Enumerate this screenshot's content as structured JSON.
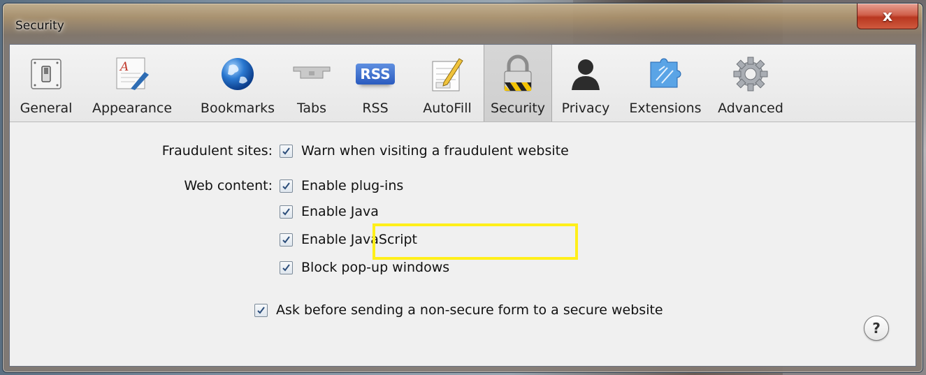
{
  "window": {
    "title": "Security",
    "close_label": "x"
  },
  "toolbar": {
    "items": [
      {
        "label": "General",
        "icon": "general-switch-icon"
      },
      {
        "label": "Appearance",
        "icon": "appearance-icon"
      },
      {
        "label": "Bookmarks",
        "icon": "globe-icon"
      },
      {
        "label": "Tabs",
        "icon": "tabs-icon"
      },
      {
        "label": "RSS",
        "icon": "rss-icon",
        "badge": "RSS"
      },
      {
        "label": "AutoFill",
        "icon": "autofill-icon"
      },
      {
        "label": "Security",
        "icon": "lock-icon",
        "selected": true
      },
      {
        "label": "Privacy",
        "icon": "person-silhouette-icon"
      },
      {
        "label": "Extensions",
        "icon": "puzzle-icon"
      },
      {
        "label": "Advanced",
        "icon": "gear-icon"
      }
    ]
  },
  "security": {
    "fraudulent_label": "Fraudulent sites:",
    "warn_fraudulent": {
      "label": "Warn when visiting a fraudulent website",
      "checked": true
    },
    "web_content_label": "Web content:",
    "enable_plugins": {
      "label": "Enable plug-ins",
      "checked": true
    },
    "enable_java": {
      "label": "Enable Java",
      "checked": true
    },
    "enable_javascript": {
      "label": "Enable JavaScript",
      "checked": true
    },
    "block_popups": {
      "label": "Block pop-up windows",
      "checked": true
    },
    "ask_nonsecure_form": {
      "label": "Ask before sending a non-secure form to a secure website",
      "checked": true
    }
  },
  "help": {
    "label": "?"
  },
  "colors": {
    "highlight": "#ffef1a",
    "close": "#c8452e"
  }
}
